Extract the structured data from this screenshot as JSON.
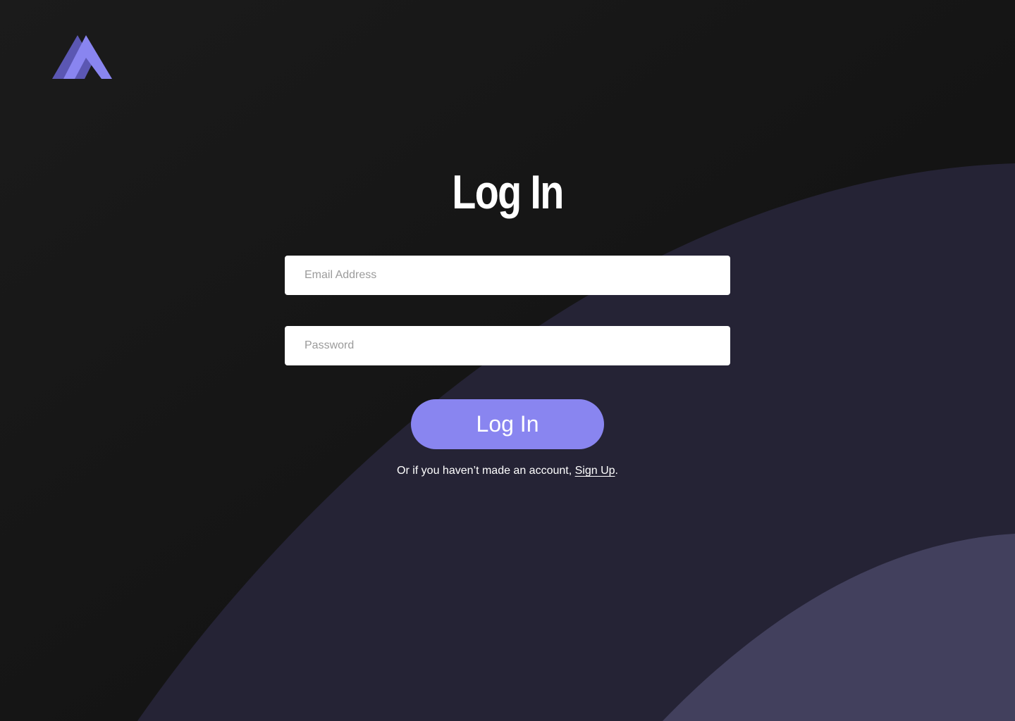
{
  "brand": {
    "logo_icon": "mountain-logo-icon",
    "logo_colors": [
      "#5b57b3",
      "#8985f0"
    ]
  },
  "page": {
    "title": "Log In"
  },
  "form": {
    "email_placeholder": "Email Address",
    "email_value": "",
    "password_placeholder": "Password",
    "password_value": "",
    "submit_label": "Log In"
  },
  "signup": {
    "prefix": "Or if you haven’t made an account, ",
    "link_label": "Sign Up",
    "suffix": "."
  },
  "colors": {
    "background": "#141414",
    "shape_dark": "#252335",
    "shape_light": "#42405d",
    "accent": "#8985f0"
  }
}
